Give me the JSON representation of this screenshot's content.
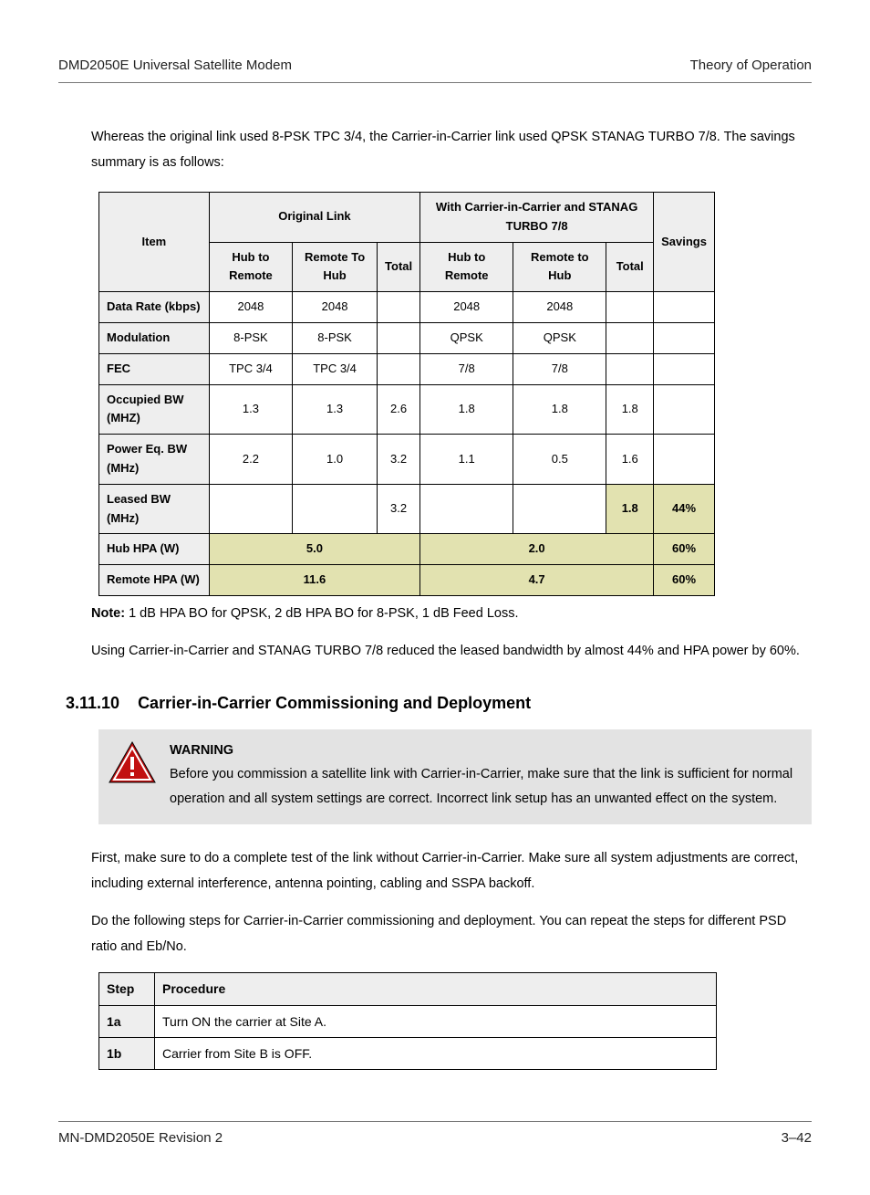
{
  "header": {
    "left": "DMD2050E Universal Satellite Modem",
    "right": "Theory of Operation"
  },
  "intro": "Whereas the original link used 8-PSK TPC 3/4, the Carrier-in-Carrier link used QPSK STANAG TURBO 7/8. The savings summary is as follows:",
  "table": {
    "col_item": "Item",
    "col_orig": "Original Link",
    "col_cnc": "With Carrier-in-Carrier and STANAG TURBO 7/8",
    "col_savings": "Savings",
    "sub_h2r": "Hub to Remote",
    "sub_r2h": "Remote To Hub",
    "sub_total": "Total",
    "sub_h2r_b": "Hub to Remote",
    "sub_r2h_b": "Remote to Hub",
    "sub_total_b": "Total",
    "rows": [
      {
        "label": "Data Rate (kbps)",
        "a1": "2048",
        "a2": "2048",
        "a3": "",
        "b1": "2048",
        "b2": "2048",
        "b3": "",
        "s": ""
      },
      {
        "label": "Modulation",
        "a1": "8-PSK",
        "a2": "8-PSK",
        "a3": "",
        "b1": "QPSK",
        "b2": "QPSK",
        "b3": "",
        "s": ""
      },
      {
        "label": "FEC",
        "a1": "TPC 3/4",
        "a2": "TPC 3/4",
        "a3": "",
        "b1": "7/8",
        "b2": "7/8",
        "b3": "",
        "s": ""
      },
      {
        "label": "Occupied BW (MHZ)",
        "a1": "1.3",
        "a2": "1.3",
        "a3": "2.6",
        "b1": "1.8",
        "b2": "1.8",
        "b3": "1.8",
        "s": ""
      },
      {
        "label": "Power Eq. BW (MHz)",
        "a1": "2.2",
        "a2": "1.0",
        "a3": "3.2",
        "b1": "1.1",
        "b2": "0.5",
        "b3": "1.6",
        "s": ""
      }
    ],
    "leased": {
      "label": "Leased BW (MHz)",
      "a1": "",
      "a2": "",
      "a3": "3.2",
      "b1": "",
      "b2": "",
      "b3": "1.8",
      "s": "44%"
    },
    "hub_hpa": {
      "label": "Hub HPA (W)",
      "a": "5.0",
      "b": "2.0",
      "s": "60%"
    },
    "remote_hpa": {
      "label": "Remote HPA (W)",
      "a": "11.6",
      "b": "4.7",
      "s": "60%"
    }
  },
  "note_label": "Note:",
  "note": " 1 dB HPA BO for QPSK, 2 dB HPA BO for 8-PSK, 1 dB Feed Loss.",
  "summary": "Using Carrier-in-Carrier and STANAG TURBO 7/8 reduced the leased bandwidth by almost 44% and HPA power by 60%.",
  "section": {
    "num": "3.11.10",
    "title": "Carrier-in-Carrier Commissioning and Deployment"
  },
  "warning": {
    "title": "WARNING",
    "text": "Before you commission a satellite link with Carrier-in-Carrier, make sure that the link is sufficient for normal operation and all system settings are correct. Incorrect link setup has an unwanted effect on the system."
  },
  "para1": "First, make sure to do a complete test of the link without Carrier-in-Carrier. Make sure all system adjustments are correct, including external interference, antenna pointing, cabling and SSPA backoff.",
  "para2": "Do the following steps for Carrier-in-Carrier commissioning and deployment. You can repeat the steps for different PSD ratio and Eb/No.",
  "steps": {
    "col_step": "Step",
    "col_proc": "Procedure",
    "rows": [
      {
        "step": "1a",
        "proc": "Turn ON the carrier at Site A."
      },
      {
        "step": "1b",
        "proc": "Carrier from Site B is OFF."
      }
    ]
  },
  "footer": {
    "left": "MN-DMD2050E   Revision 2",
    "right": "3–42"
  }
}
